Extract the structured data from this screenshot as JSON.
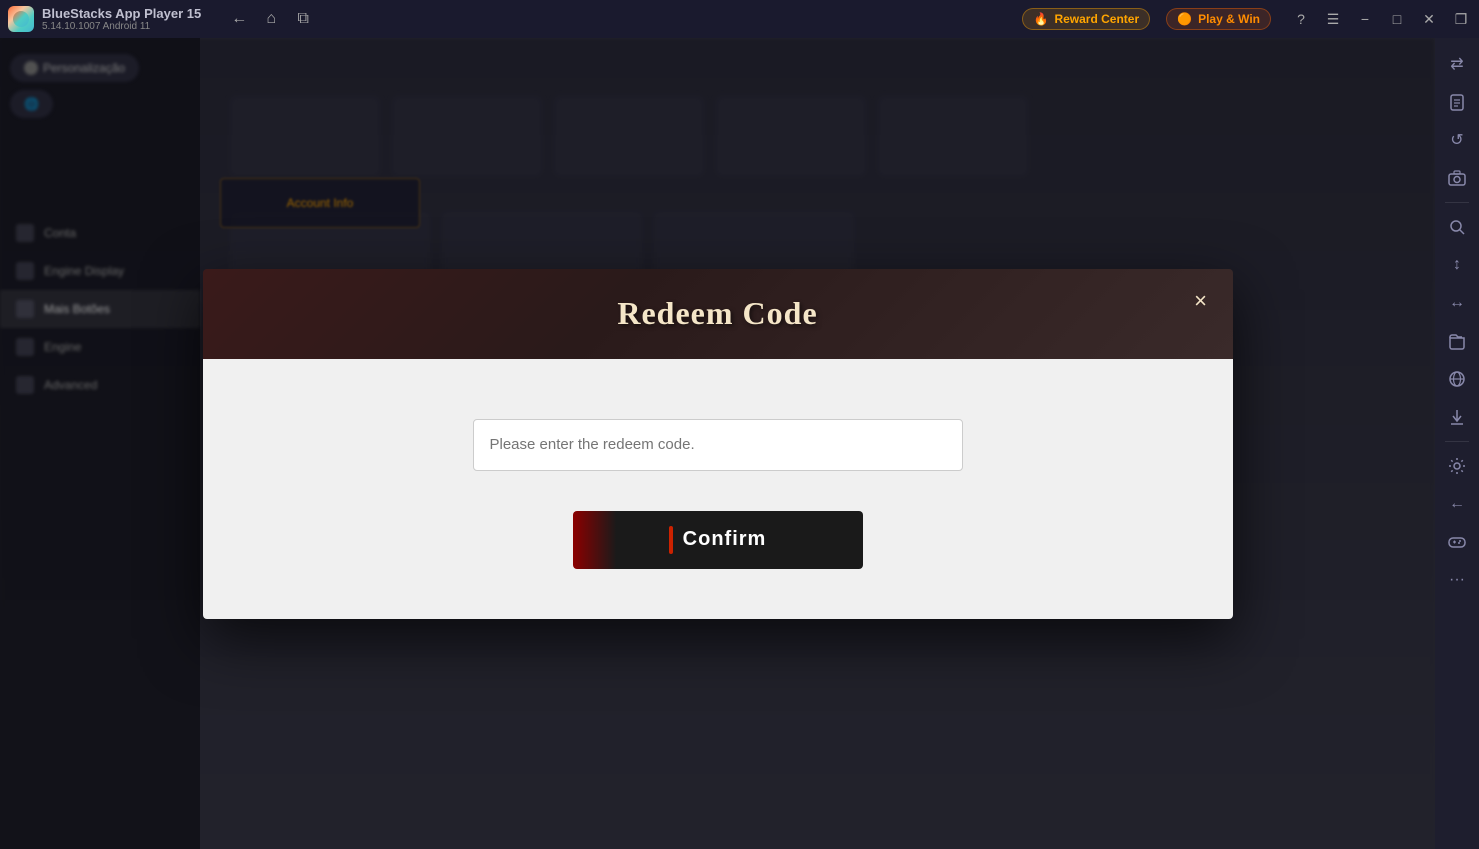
{
  "titleBar": {
    "appName": "BlueStacks App Player 15",
    "appVersion": "5.14.10.1007  Android 11",
    "rewardCenterLabel": "Reward Center",
    "playWinLabel": "Play & Win"
  },
  "navigation": {
    "back": "←",
    "home": "⌂",
    "tabs": "⧉"
  },
  "windowControls": {
    "help": "?",
    "menu": "☰",
    "minimize": "−",
    "maximize": "□",
    "close": "✕",
    "restore": "❐"
  },
  "rightSidebar": {
    "icons": [
      "⇄",
      "📋",
      "↺",
      "📷",
      "🔎",
      "↕",
      "↔",
      "📁",
      "🌐",
      "📥",
      "⚙",
      "←",
      "🎮",
      "···"
    ]
  },
  "modal": {
    "title": "Redeem Code",
    "closeLabel": "×",
    "inputPlaceholder": "Please enter the redeem code.",
    "confirmLabel": "Confirm"
  },
  "leftMenu": {
    "items": [
      {
        "label": "Personalização"
      },
      {
        "label": "Conta"
      },
      {
        "label": "Engine Display"
      },
      {
        "label": "Mais Botões"
      },
      {
        "label": "Engine"
      },
      {
        "label": "Advanced"
      }
    ]
  },
  "colors": {
    "accent": "#cc2200",
    "modalHeaderBg": "#2a1a1a",
    "confirmBtnBg": "#1a1a1a",
    "titleBarBg": "#1a1a2e"
  }
}
